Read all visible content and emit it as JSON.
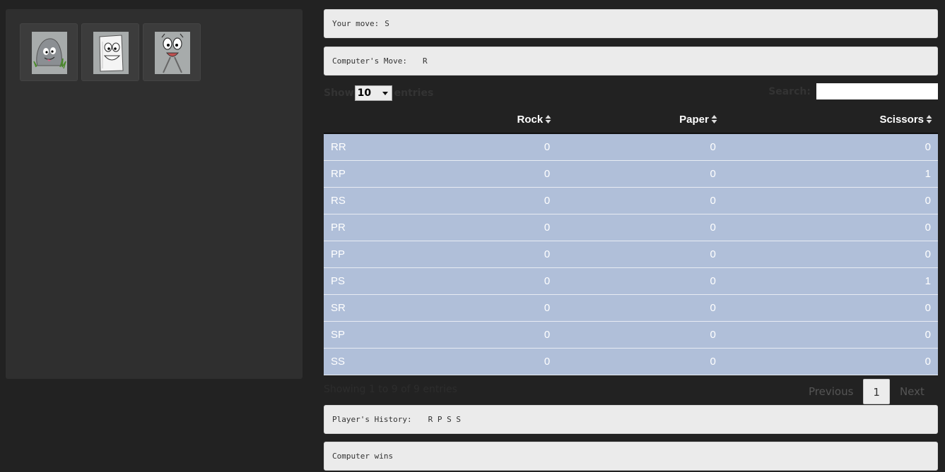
{
  "moves": {
    "rock": {
      "name": "rock-button"
    },
    "paper": {
      "name": "paper-button"
    },
    "scissors": {
      "name": "scissors-button"
    }
  },
  "your_move": {
    "label": "Your move:",
    "value": "S"
  },
  "computer_move": {
    "label": "Computer's Move:",
    "value": "R"
  },
  "length": {
    "show": "Show",
    "value": "10",
    "entries": "entries"
  },
  "search": {
    "label": "Search:",
    "value": ""
  },
  "table": {
    "headers": [
      "",
      "Rock",
      "Paper",
      "Scissors"
    ],
    "rows": [
      [
        "RR",
        "0",
        "0",
        "0"
      ],
      [
        "RP",
        "0",
        "0",
        "1"
      ],
      [
        "RS",
        "0",
        "0",
        "0"
      ],
      [
        "PR",
        "0",
        "0",
        "0"
      ],
      [
        "PP",
        "0",
        "0",
        "0"
      ],
      [
        "PS",
        "0",
        "0",
        "1"
      ],
      [
        "SR",
        "0",
        "0",
        "0"
      ],
      [
        "SP",
        "0",
        "0",
        "0"
      ],
      [
        "SS",
        "0",
        "0",
        "0"
      ]
    ]
  },
  "info": "Showing 1 to 9 of 9 entries",
  "paging": {
    "previous": "Previous",
    "current": "1",
    "next": "Next"
  },
  "history": {
    "label": "Player's History:",
    "value": "R P S S"
  },
  "result": "Computer wins",
  "colors": {
    "background": "#222222",
    "row": "#b0bfd9",
    "well": "#ebebeb"
  }
}
